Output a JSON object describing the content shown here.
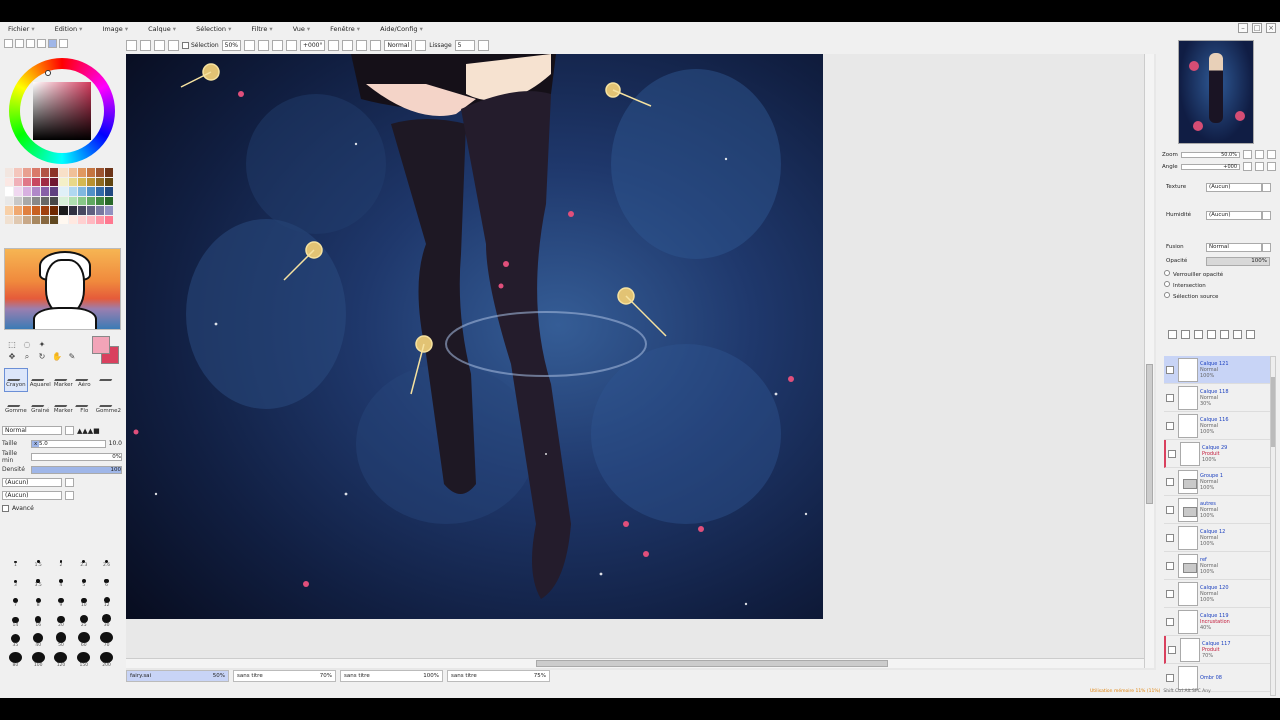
{
  "app": {
    "menus": [
      "Fichier",
      "Edition",
      "Image",
      "Calque",
      "Sélection",
      "Filtre",
      "Vue",
      "Fenêtre",
      "Aide/Config"
    ]
  },
  "toolbar": {
    "selection_label": "Sélection",
    "zoom_value": "50%",
    "angle_value": "+000°",
    "blend_value": "Normal",
    "lissage_label": "Lissage",
    "lissage_value": "5"
  },
  "brushes": [
    {
      "name": "Crayon",
      "selected": true
    },
    {
      "name": "Aquarel",
      "selected": false
    },
    {
      "name": "Marker",
      "selected": false
    },
    {
      "name": "Aéro",
      "selected": false
    },
    {
      "name": "",
      "selected": false
    },
    {
      "name": "Gomme",
      "selected": false
    },
    {
      "name": "Grainé",
      "selected": false
    },
    {
      "name": "Marker",
      "selected": false
    },
    {
      "name": "Flo",
      "selected": false
    },
    {
      "name": "Gomme2",
      "selected": false
    }
  ],
  "brush_props": {
    "blend": "Normal",
    "taille_label": "Taille",
    "taille_value": "x 5.0",
    "taille_max": "10.0",
    "taille_fill": 0.1,
    "taille_min_label": "Taille min",
    "taille_min_value": "0%",
    "densite_label": "Densité",
    "densite_value": "100",
    "densite_fill": 1.0,
    "texture1": "(Aucun)",
    "texture2": "(Aucun)",
    "avance_label": "Avancé"
  },
  "brush_sizes": [
    "1",
    "1.5",
    "2",
    "2.3",
    "2.6",
    "3",
    "3.5",
    "4",
    "5",
    "6",
    "7",
    "8",
    "9",
    "10",
    "12",
    "14",
    "16",
    "20",
    "25",
    "30",
    "35",
    "40",
    "50",
    "60",
    "70",
    "80",
    "100",
    "120",
    "150",
    "200"
  ],
  "right": {
    "zoom_label": "Zoom",
    "zoom_value": "50.0%",
    "angle_label": "Angle",
    "angle_value": "+000",
    "texture_label": "Texture",
    "texture_value": "(Aucun)",
    "humid_label": "Humidité",
    "humid_value": "(Aucun)",
    "fusion_label": "Fusion",
    "fusion_value": "Normal",
    "opacity_label": "Opacité",
    "opacity_value": "100%",
    "opacity_fill": 1.0,
    "options": [
      "Verrouiller opacité",
      "Intersection",
      "Sélection source"
    ]
  },
  "layers": [
    {
      "name": "Calque 121",
      "mode": "Normal",
      "opacity": "100%",
      "selected": true,
      "marked": false,
      "folder": false,
      "red": false
    },
    {
      "name": "Calque 118",
      "mode": "Normal",
      "opacity": "30%",
      "selected": false,
      "marked": false,
      "folder": false,
      "red": false
    },
    {
      "name": "Calque 116",
      "mode": "Normal",
      "opacity": "100%",
      "selected": false,
      "marked": false,
      "folder": false,
      "red": false
    },
    {
      "name": "Calque 29",
      "mode": "Produit",
      "opacity": "100%",
      "selected": false,
      "marked": true,
      "folder": false,
      "red": true
    },
    {
      "name": "Groupe 1",
      "mode": "Normal",
      "opacity": "100%",
      "selected": false,
      "marked": false,
      "folder": true,
      "red": false
    },
    {
      "name": "autres",
      "mode": "Normal",
      "opacity": "100%",
      "selected": false,
      "marked": false,
      "folder": true,
      "red": false
    },
    {
      "name": "Calque 12",
      "mode": "Normal",
      "opacity": "100%",
      "selected": false,
      "marked": false,
      "folder": false,
      "red": false
    },
    {
      "name": "ref",
      "mode": "Normal",
      "opacity": "100%",
      "selected": false,
      "marked": false,
      "folder": true,
      "red": false
    },
    {
      "name": "Calque 120",
      "mode": "Normal",
      "opacity": "100%",
      "selected": false,
      "marked": false,
      "folder": false,
      "red": false
    },
    {
      "name": "Calque 119",
      "mode": "Incrustation",
      "opacity": "40%",
      "selected": false,
      "marked": false,
      "folder": false,
      "red": true
    },
    {
      "name": "Calque 117",
      "mode": "Produit",
      "opacity": "70%",
      "selected": false,
      "marked": true,
      "folder": false,
      "red": true
    },
    {
      "name": "Ombr 08",
      "mode": "",
      "opacity": "",
      "selected": false,
      "marked": false,
      "folder": false,
      "red": false
    }
  ],
  "docs": [
    {
      "name": "fairy.sai",
      "zoom": "50%",
      "active": true
    },
    {
      "name": "sans titre",
      "zoom": "70%",
      "active": false
    },
    {
      "name": "sans titre",
      "zoom": "100%",
      "active": false
    },
    {
      "name": "sans titre",
      "zoom": "75%",
      "active": false
    }
  ],
  "status": {
    "warn": "Utilisation mémoire 11% (11%)",
    "keys": "Shift Ctrl Alt SPC  Any"
  }
}
